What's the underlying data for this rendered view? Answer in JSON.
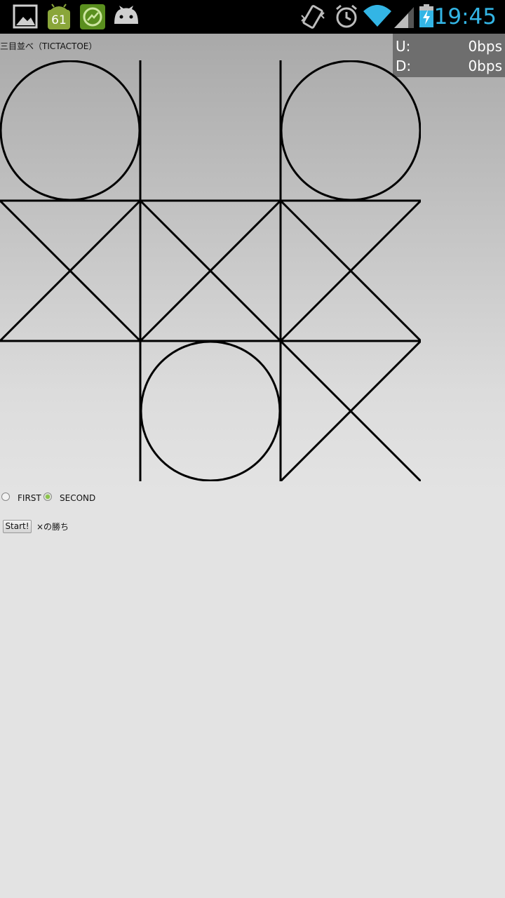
{
  "status_bar": {
    "time": "19:45",
    "notification_badge": "61",
    "icons": [
      "gallery-icon",
      "android-update-icon",
      "stats-app-icon",
      "android-cat-icon",
      "vibrate-icon",
      "alarm-icon",
      "wifi-icon",
      "signal-icon",
      "battery-charging-icon"
    ]
  },
  "speed_meter": {
    "up_label": "U:",
    "up_value": "0bps",
    "down_label": "D:",
    "down_value": "0bps"
  },
  "app": {
    "title": "三目並べ（TICTACTOE）",
    "board": [
      [
        "O",
        "",
        "O"
      ],
      [
        "X",
        "X",
        "X"
      ],
      [
        "",
        "O",
        "X"
      ]
    ],
    "options": [
      {
        "label": "FIRST",
        "checked": false
      },
      {
        "label": "SECOND",
        "checked": true
      }
    ],
    "start_label": "Start!",
    "result_text": "×の勝ち"
  },
  "colors": {
    "clock": "#33b5e5",
    "radio_checked": "#8bc34a",
    "line": "#000000"
  }
}
